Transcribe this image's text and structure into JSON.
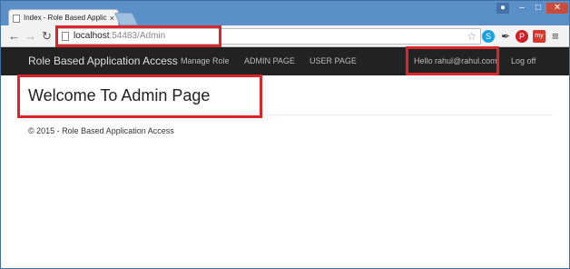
{
  "browser": {
    "tab_title": "Index - Role Based Applic",
    "tab_close": "×",
    "url_host": "localhost",
    "url_rest": ":54483/Admin",
    "icons": {
      "back": "back-arrow-icon",
      "forward": "forward-arrow-icon",
      "reload": "reload-icon",
      "star": "star-icon",
      "menu": "menu-icon"
    },
    "ext_my_label": "my"
  },
  "navbar": {
    "brand": "Role Based Application Access",
    "links": [
      "Manage Role",
      "ADMIN PAGE",
      "USER PAGE"
    ],
    "hello": "Hello rahul@rahul.com!",
    "logoff": "Log off",
    "bg_color": "#222222"
  },
  "main": {
    "heading": "Welcome To Admin Page"
  },
  "footer": {
    "text": "© 2015 - Role Based Application Access"
  },
  "annotation_color": "#d9262b"
}
